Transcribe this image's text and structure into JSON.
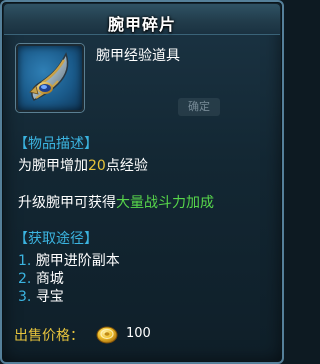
{
  "tooltip": {
    "title": "腕甲碎片",
    "item_type": "腕甲经验道具",
    "background_label": "确定",
    "description": {
      "header": "【物品描述】",
      "line1_prefix": "为腕甲增加",
      "line1_value": "20",
      "line1_suffix": "点经验",
      "line2_prefix": "升级腕甲可获得",
      "line2_highlight": "大量战斗力加成"
    },
    "sources": {
      "header": "【获取途径】",
      "items": [
        {
          "num": "1.",
          "text": "腕甲进阶副本"
        },
        {
          "num": "2.",
          "text": "商城"
        },
        {
          "num": "3.",
          "text": "寻宝"
        }
      ]
    },
    "price": {
      "label": "出售价格：",
      "currency_icon": "gold-coin-icon",
      "value": "100"
    },
    "icon": "bracer-fragment-icon",
    "colors": {
      "section_header": "#3bb4e0",
      "highlight_yellow": "#e8c33a",
      "highlight_green": "#57d64b",
      "price_label": "#e6c33d"
    }
  }
}
